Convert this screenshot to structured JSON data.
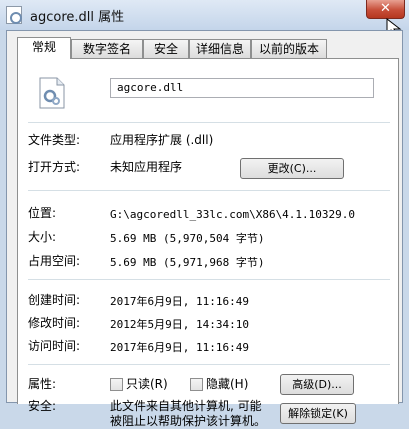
{
  "window": {
    "title": "agcore.dll 属性",
    "close_glyph": "✕"
  },
  "tabs": [
    {
      "label": "常规",
      "active": true
    },
    {
      "label": "数字签名",
      "active": false
    },
    {
      "label": "安全",
      "active": false
    },
    {
      "label": "详细信息",
      "active": false
    },
    {
      "label": "以前的版本",
      "active": false
    }
  ],
  "general": {
    "filename": "agcore.dll",
    "file_type_label": "文件类型:",
    "file_type_value": "应用程序扩展 (.dll)",
    "open_with_label": "打开方式:",
    "open_with_value": "未知应用程序",
    "change_button": "更改(C)...",
    "location_label": "位置:",
    "location_value": "G:\\agcoredll_33lc.com\\X86\\4.1.10329.0",
    "size_label": "大小:",
    "size_value": "5.69 MB (5,970,504 字节)",
    "disk_size_label": "占用空间:",
    "disk_size_value": "5.69 MB (5,971,968 字节)",
    "created_label": "创建时间:",
    "created_value": "2017年6月9日, 11:16:49",
    "modified_label": "修改时间:",
    "modified_value": "2012年5月9日, 14:34:10",
    "accessed_label": "访问时间:",
    "accessed_value": "2017年6月9日, 11:16:49",
    "attributes_label": "属性:",
    "readonly_label": "只读(R)",
    "hidden_label": "隐藏(H)",
    "advanced_button": "高级(D)...",
    "security_label": "安全:",
    "security_text_line1": "此文件来自其他计算机, 可能",
    "security_text_line2": "被阻止以帮助保护该计算机。",
    "unblock_button": "解除锁定(K)"
  },
  "colors": {
    "title_bar": "#c4d5ea",
    "close_button": "#c74f3a",
    "panel_background": "#ffffff",
    "window_background": "#f0f0f0"
  },
  "icons": {
    "title": "dll-file-icon",
    "file": "dll-file-icon",
    "close": "close-icon",
    "cursor": "mouse-cursor-icon"
  }
}
